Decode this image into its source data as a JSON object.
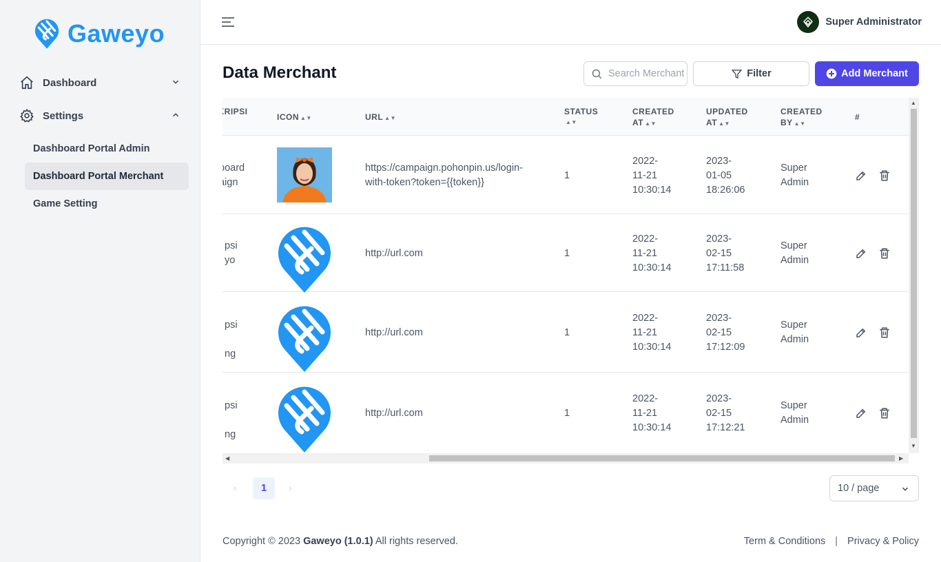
{
  "app": {
    "name": "Gaweyo"
  },
  "sidebar": {
    "groups": [
      {
        "label": "Dashboard",
        "icon": "home-icon",
        "expanded": false
      },
      {
        "label": "Settings",
        "icon": "gear-icon",
        "expanded": true
      }
    ],
    "sub_items": [
      {
        "label": "Dashboard Portal Admin",
        "active": false
      },
      {
        "label": "Dashboard Portal Merchant",
        "active": true
      },
      {
        "label": "Game Setting",
        "active": false
      }
    ]
  },
  "header": {
    "user_name": "Super Administrator"
  },
  "page": {
    "title": "Data Merchant",
    "search_placeholder": "Search Merchant",
    "filter_label": "Filter",
    "add_label": "Add Merchant"
  },
  "table": {
    "columns": {
      "description": "SKRIPSI",
      "icon": "ICON",
      "url": "URL",
      "status": "STATUS",
      "created_at_1": "CREATED",
      "created_at_2": "AT",
      "updated_at_1": "UPDATED",
      "updated_at_2": "AT",
      "created_by_1": "CREATED",
      "created_by_2": "BY",
      "actions": "#"
    },
    "rows": [
      {
        "desc_1": "board",
        "desc_2": "aign",
        "desc_3": "",
        "icon": "photo-avatar",
        "url_1": "https://campaign.pohonpin.us/login-",
        "url_2": "with-token?token={{token}}",
        "status": "1",
        "created_1": "2022-",
        "created_2": "11-21",
        "created_3": "10:30:14",
        "updated_1": "2023-",
        "updated_2": "01-05",
        "updated_3": "18:26:06",
        "by_1": "Super",
        "by_2": "Admin"
      },
      {
        "desc_1": "psi",
        "desc_2": "yo",
        "desc_3": "",
        "icon": "gaweyo-logo",
        "url_1": "http://url.com",
        "url_2": "",
        "status": "1",
        "created_1": "2022-",
        "created_2": "11-21",
        "created_3": "10:30:14",
        "updated_1": "2023-",
        "updated_2": "02-15",
        "updated_3": "17:11:58",
        "by_1": "Super",
        "by_2": "Admin"
      },
      {
        "desc_1": "psi",
        "desc_2": "",
        "desc_3": "ng",
        "icon": "gaweyo-logo",
        "url_1": "http://url.com",
        "url_2": "",
        "status": "1",
        "created_1": "2022-",
        "created_2": "11-21",
        "created_3": "10:30:14",
        "updated_1": "2023-",
        "updated_2": "02-15",
        "updated_3": "17:12:09",
        "by_1": "Super",
        "by_2": "Admin"
      },
      {
        "desc_1": "psi",
        "desc_2": "",
        "desc_3": "ng",
        "icon": "gaweyo-logo",
        "url_1": "http://url.com",
        "url_2": "",
        "status": "1",
        "created_1": "2022-",
        "created_2": "11-21",
        "created_3": "10:30:14",
        "updated_1": "2023-",
        "updated_2": "02-15",
        "updated_3": "17:12:21",
        "by_1": "Super",
        "by_2": "Admin"
      }
    ]
  },
  "pagination": {
    "current": "1",
    "page_size": "10 / page"
  },
  "footer": {
    "copyright_prefix": "Copyright © 2023 ",
    "brand": "Gaweyo (1.0.1)",
    "copyright_suffix": " All rights reserved.",
    "terms": "Term & Conditions",
    "privacy": "Privacy & Policy"
  },
  "colors": {
    "brand": "#2196f3",
    "primary": "#4f46e5",
    "avatar_bg": "#0f2e14"
  }
}
